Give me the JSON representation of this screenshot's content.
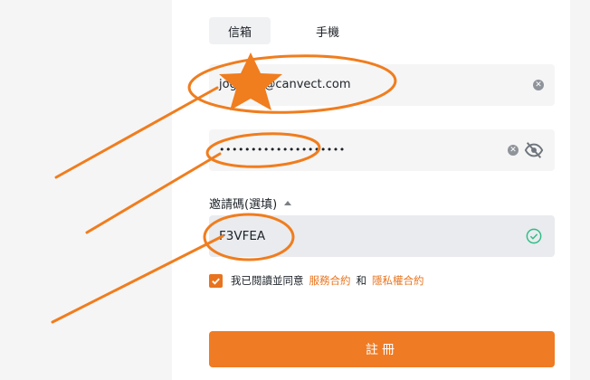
{
  "tabs": {
    "email_label": "信箱",
    "phone_label": "手機"
  },
  "email_field": {
    "value": "jog…66@canvect.com"
  },
  "password_field": {
    "masked_value": "••••••••••••••••••••"
  },
  "invite": {
    "label": "邀請碼(選填)",
    "value": "F3VFEA"
  },
  "agreement": {
    "prefix": "我已閱讀並同意",
    "terms_link": "服務合約",
    "joiner": "和",
    "privacy_link": "隱私權合約",
    "checked": true
  },
  "register_button": {
    "label": "註冊"
  },
  "colors": {
    "accent": "#ef7b24",
    "annotation": "#f07d1e",
    "success": "#2ebd85"
  },
  "icons": [
    "clear-icon",
    "eye-off-icon",
    "check-circle-icon",
    "caret-up-icon",
    "checkmark-icon",
    "star-icon"
  ]
}
